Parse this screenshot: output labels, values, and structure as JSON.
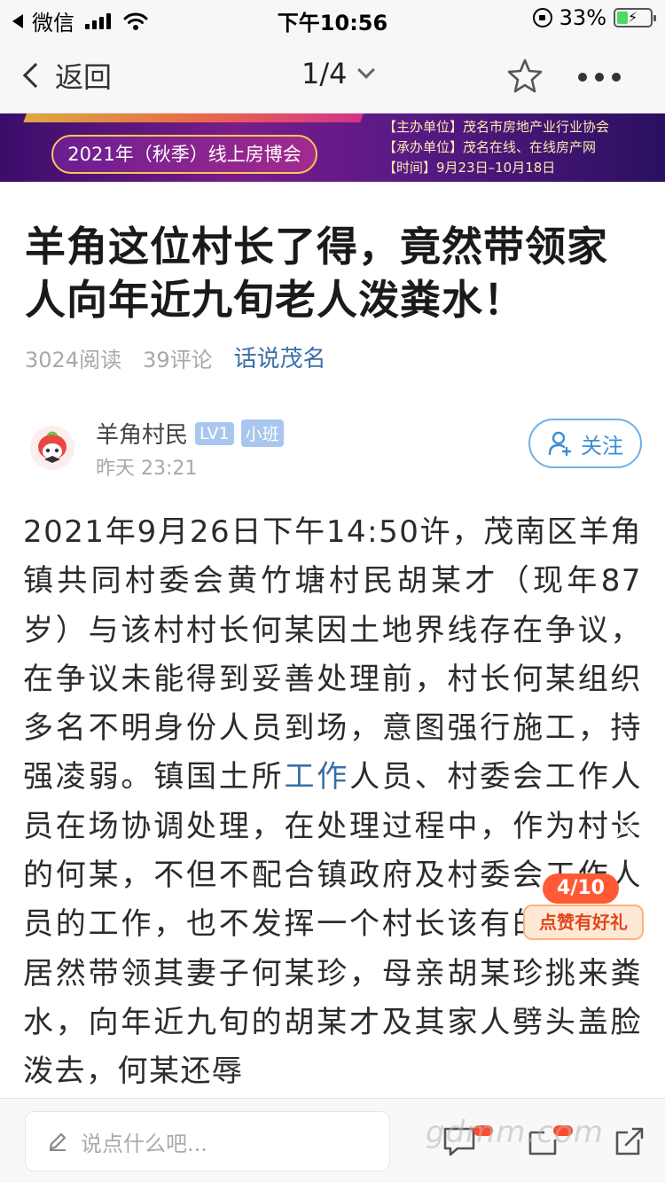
{
  "status_bar": {
    "carrier": "微信",
    "time": "下午10:56",
    "battery_percent": "33%",
    "battery_level": 0.33
  },
  "nav": {
    "back_label": "返回",
    "page_indicator": "1/4",
    "icons": [
      "chevron-left-icon",
      "chevron-down-icon",
      "star-icon",
      "more-icon"
    ]
  },
  "banner": {
    "event_label": "2021年（秋季）线上房博会",
    "info_lines": [
      "【主办单位】茂名市房地产业行业协会",
      "【承办单位】茂名在线、在线房产网",
      "【时间】9月23日–10月18日"
    ]
  },
  "article": {
    "title": "羊角这位村长了得，竟然带领家人向年近九旬老人泼粪水！",
    "reads": "3024阅读",
    "comments": "39评论",
    "topic": "话说茂名",
    "author": {
      "name": "羊角村民",
      "level_badge": "LV1",
      "class_badge": "小班",
      "time": "昨天 23:21",
      "follow_label": "关注"
    },
    "body_before": "2021年9月26日下午14:50许，茂南区羊角镇共同村委会黄竹塘村民胡某才（现年87岁）与该村村长何某因土地界线存在争议，在争议未能得到妥善处理前，村长何某组织多名不明身份人员到场，意图强行施工，持强凌弱。镇国土所",
    "body_keyword": "工作",
    "body_after": "人员、村委会工作人员在场协调处理，在处理过程中，作为村长的何某，不但不配合镇政府及村委会工作人员的工作，也不发挥一个村长该有的担当，居然带领其妻子何某珍，母亲胡某珍挑来粪水，向年近九旬的胡某才及其家人劈头盖脸泼去，何某还辱"
  },
  "like_widget": {
    "count": "4/10",
    "label": "点赞有好礼"
  },
  "bottom_bar": {
    "comment_placeholder": "说点什么吧...",
    "watermark": "gdmm.com"
  },
  "colors": {
    "accent_blue": "#3d8ed6",
    "link_blue": "#3a6fa8",
    "like_red": "#ff5a36",
    "battery_green": "#4cd964"
  }
}
